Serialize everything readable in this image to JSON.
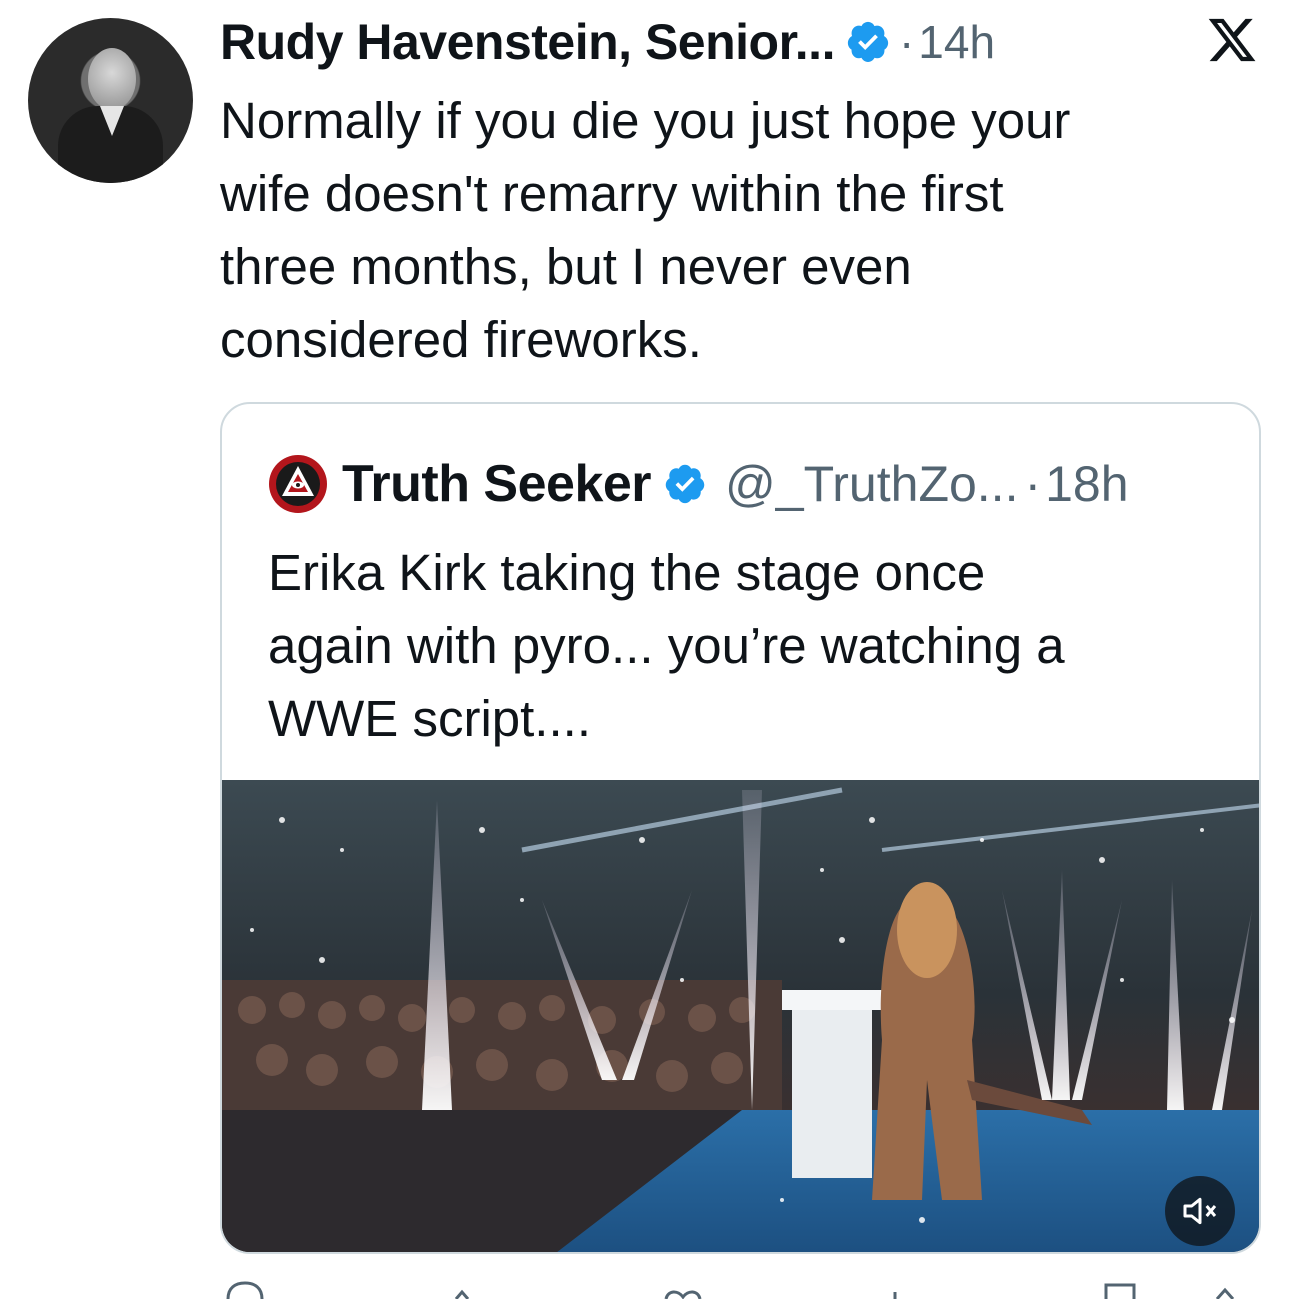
{
  "tweet": {
    "author_name": "Rudy Havenstein, Senior...",
    "separator": "·",
    "time": "14h",
    "text_lines": [
      "Normally if you die you just hope your",
      "wife doesn't remarry within the first",
      "three months, but I never even",
      "considered fireworks."
    ]
  },
  "quote": {
    "author_name": "Truth Seeker",
    "handle": "@_TruthZo...",
    "separator": "·",
    "time": "18h",
    "text_lines": [
      "Erika Kirk taking the stage once",
      "again with pyro... you’re watching a",
      "WWE script...."
    ]
  },
  "icons": {
    "verified": "verified-badge-icon",
    "brand": "x-logo-icon",
    "mute": "volume-muted-icon",
    "actions": [
      "reply-icon",
      "retweet-icon",
      "like-icon",
      "views-icon",
      "bookmark-icon",
      "share-icon"
    ]
  },
  "colors": {
    "verified_blue": "#1d9bf0",
    "secondary_text": "#536471",
    "border": "#cfd9de"
  }
}
